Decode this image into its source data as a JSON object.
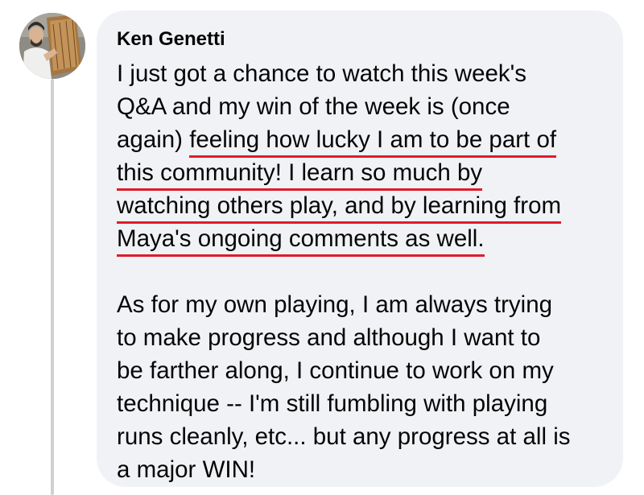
{
  "comment": {
    "author": "Ken Genetti",
    "paragraph1": {
      "line1": "I just got a chance to watch this week's",
      "line2": "Q&A and my win of the week is (once",
      "line3_plain": "again) ",
      "line3_underlined": "feeling how lucky I am to be part of",
      "line4_underlined": "this community! I learn so much by",
      "line5_underlined": "watching others play, and by learning from",
      "line6_underlined": "Maya's ongoing comments as well."
    },
    "paragraph2": {
      "line1": "As for my own playing, I am always trying",
      "line2": "to make progress and although I want to",
      "line3": "be farther along, I continue to work on my",
      "line4": "technique -- I'm still fumbling with playing",
      "line5": "runs cleanly, etc... but any progress at all is",
      "line6": "a major WIN!"
    }
  },
  "colors": {
    "bubble_background": "#f0f2f5",
    "text": "#050505",
    "underline": "#e01b2a",
    "thread_line": "#ced0d4"
  }
}
